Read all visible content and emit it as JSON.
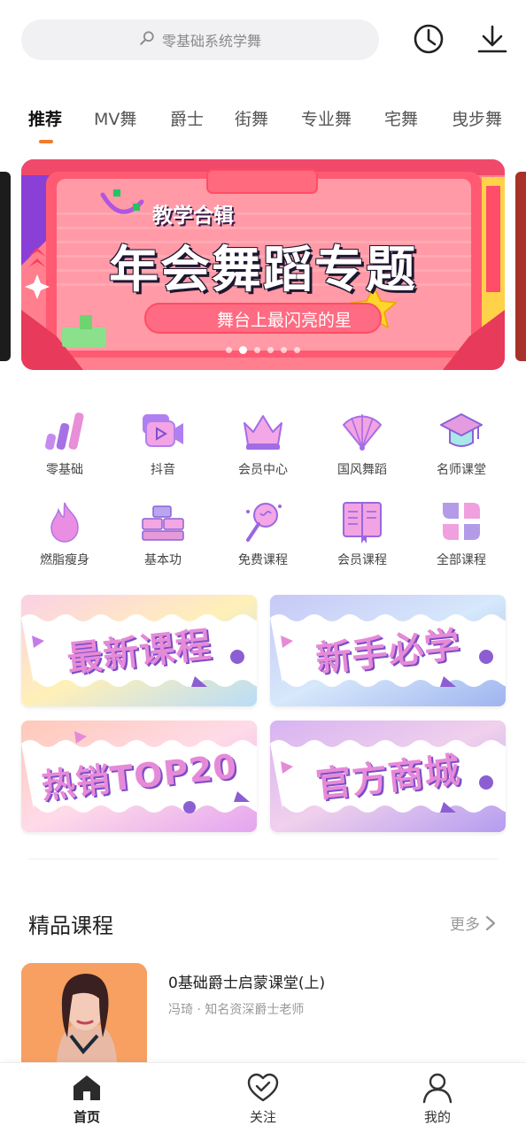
{
  "search": {
    "placeholder": "零基础系统学舞"
  },
  "header": {
    "history_icon": "clock-icon",
    "download_icon": "download-icon"
  },
  "tabs": [
    {
      "label": "推荐",
      "active": true
    },
    {
      "label": "MV舞"
    },
    {
      "label": "爵士"
    },
    {
      "label": "街舞"
    },
    {
      "label": "专业舞"
    },
    {
      "label": "宅舞"
    },
    {
      "label": "曳步舞"
    }
  ],
  "banner": {
    "kicker": "教学合辑",
    "title": "年会舞蹈专题",
    "subtitle": "舞台上最闪亮的星",
    "slide_count": 6,
    "active_slide": 2
  },
  "categories": [
    {
      "label": "零基础",
      "icon": "bar-chart-icon"
    },
    {
      "label": "抖音",
      "icon": "video-icon"
    },
    {
      "label": "会员中心",
      "icon": "crown-icon"
    },
    {
      "label": "国风舞蹈",
      "icon": "fan-icon"
    },
    {
      "label": "名师课堂",
      "icon": "graduation-cap-icon"
    },
    {
      "label": "燃脂瘦身",
      "icon": "flame-icon"
    },
    {
      "label": "基本功",
      "icon": "blocks-icon"
    },
    {
      "label": "免费课程",
      "icon": "lollipop-icon"
    },
    {
      "label": "会员课程",
      "icon": "book-icon"
    },
    {
      "label": "全部课程",
      "icon": "grid-icon"
    }
  ],
  "promos": [
    {
      "label": "最新课程"
    },
    {
      "label": "新手必学"
    },
    {
      "label": "热销TOP20"
    },
    {
      "label": "官方商城"
    }
  ],
  "section": {
    "title": "精品课程",
    "more": "更多"
  },
  "course": {
    "title": "0基础爵士启蒙课堂(上)",
    "subtitle": "冯琦 · 知名资深爵士老师"
  },
  "bottom_nav": [
    {
      "label": "首页",
      "icon": "home-icon",
      "active": true
    },
    {
      "label": "关注",
      "icon": "heart-check-icon"
    },
    {
      "label": "我的",
      "icon": "user-icon"
    }
  ],
  "colors": {
    "accent": "#f07c2c",
    "banner": "#ff8a9a",
    "icon_purple": "#c07ee8",
    "icon_pink": "#f08fd8"
  }
}
